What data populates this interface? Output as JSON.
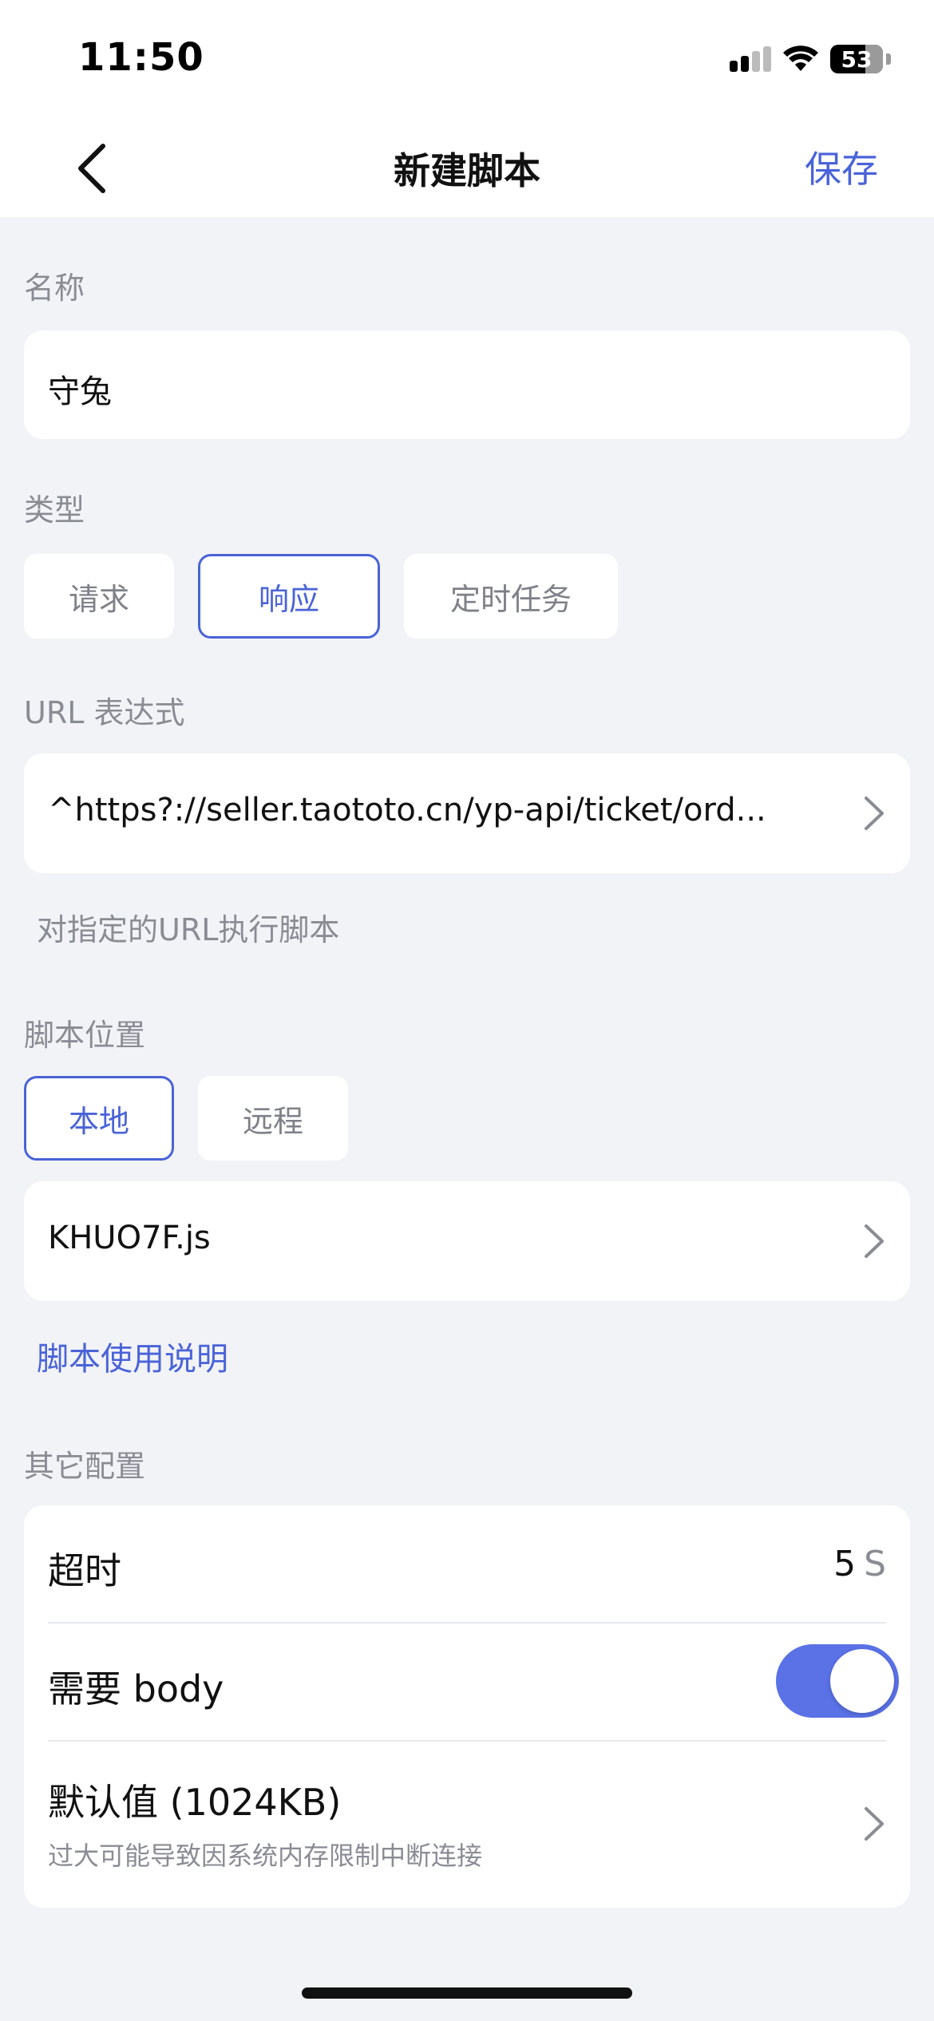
{
  "status_bar": {
    "time": "11:50",
    "battery": "53"
  },
  "nav": {
    "title": "新建脚本",
    "save_label": "保存"
  },
  "name_section": {
    "label": "名称",
    "value": "守兔"
  },
  "type_section": {
    "label": "类型",
    "options": [
      "请求",
      "响应",
      "定时任务"
    ],
    "selected": "响应"
  },
  "url_section": {
    "label": "URL 表达式",
    "value": "^https?://seller.taototo.cn/yp-api/ticket/ord...",
    "hint": "对指定的URL执行脚本"
  },
  "location_section": {
    "label": "脚本位置",
    "options": [
      "本地",
      "远程"
    ],
    "selected": "本地",
    "file": "KHUO7F.js",
    "help_link": "脚本使用说明"
  },
  "other_section": {
    "label": "其它配置",
    "timeout": {
      "label": "超时",
      "value": "5",
      "unit": "S"
    },
    "need_body": {
      "label": "需要 body",
      "enabled": true
    },
    "default_value": {
      "label": "默认值 (1024KB)",
      "subtitle": "过大可能导致因系统内存限制中断连接"
    }
  },
  "colors": {
    "accent": "#4a63d8",
    "toggle_on": "#5a72e6",
    "background": "#f2f3f7"
  }
}
